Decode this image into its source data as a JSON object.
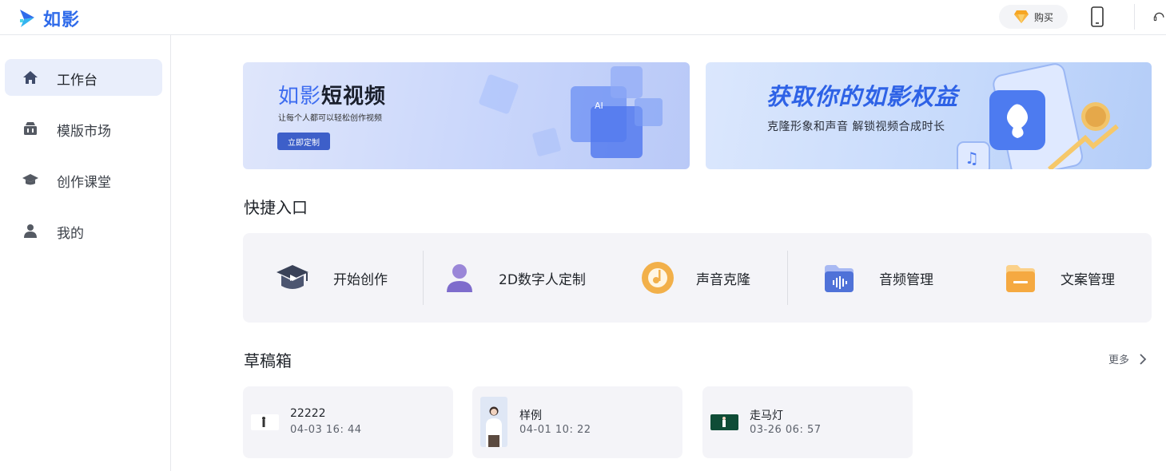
{
  "app": {
    "name": "如影"
  },
  "header": {
    "buy_label": "购买"
  },
  "sidebar": {
    "items": [
      {
        "label": "工作台",
        "icon": "home-icon",
        "active": true
      },
      {
        "label": "模版市场",
        "icon": "store-icon"
      },
      {
        "label": "创作课堂",
        "icon": "graduation-cap-icon"
      },
      {
        "label": "我的",
        "icon": "user-icon"
      }
    ]
  },
  "banners": {
    "short_video": {
      "title_prefix": "如影",
      "title_suffix": "短视频",
      "subtitle": "让每个人都可以轻松创作视频",
      "button": "立即定制",
      "badge": "AI"
    },
    "benefits": {
      "title": "获取你的如影权益",
      "subtitle": "克隆形象和声音 解锁视频合成时长"
    }
  },
  "quick_entry": {
    "title": "快捷入口",
    "items": [
      {
        "label": "开始创作",
        "icon": "play-graduation-icon"
      },
      {
        "label": "2D数字人定制",
        "icon": "digital-human-icon"
      },
      {
        "label": "声音克隆",
        "icon": "music-note-icon"
      },
      {
        "label": "音频管理",
        "icon": "audio-folder-icon"
      },
      {
        "label": "文案管理",
        "icon": "text-folder-icon"
      }
    ]
  },
  "drafts": {
    "title": "草稿箱",
    "more_label": "更多",
    "items": [
      {
        "name": "22222",
        "time": "04-03  16: 44"
      },
      {
        "name": "样例",
        "time": "04-01  10: 22"
      },
      {
        "name": "走马灯",
        "time": "03-26  06: 57"
      }
    ]
  },
  "colors": {
    "accent": "#2f6bea",
    "active_bg": "#e9eefb",
    "panel_bg": "#f4f4f8"
  }
}
